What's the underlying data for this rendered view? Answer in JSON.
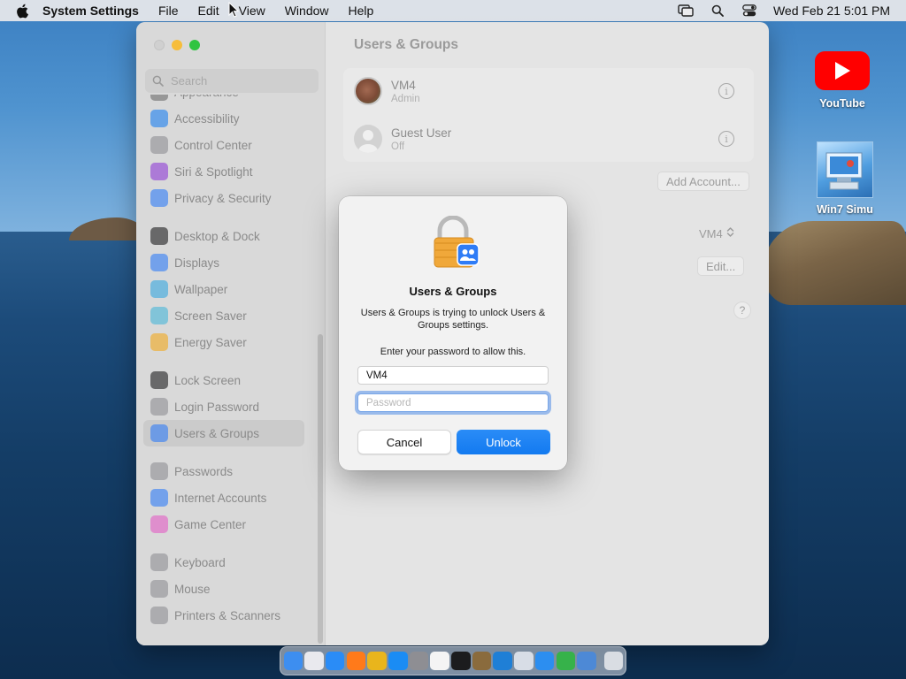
{
  "menubar": {
    "app_name": "System Settings",
    "menus": [
      "File",
      "Edit",
      "View",
      "Window",
      "Help"
    ],
    "clock": "Wed Feb 21  5:01 PM"
  },
  "window": {
    "title": "Users & Groups",
    "search_placeholder": "Search",
    "sidebar": [
      {
        "label": "Appearance",
        "icon": "appearance-icon",
        "color": "#6b6b6b"
      },
      {
        "label": "Accessibility",
        "icon": "accessibility-icon",
        "color": "#1a7ef0"
      },
      {
        "label": "Control Center",
        "icon": "control-center-icon",
        "color": "#8e8e93"
      },
      {
        "label": "Siri & Spotlight",
        "icon": "siri-icon",
        "color": "#8e3ad6"
      },
      {
        "label": "Privacy & Security",
        "icon": "hand-icon",
        "color": "#2f7cf6"
      },
      {
        "label": "Desktop & Dock",
        "icon": "dock-icon",
        "color": "#1c1c1e"
      },
      {
        "label": "Displays",
        "icon": "displays-icon",
        "color": "#2f7cf6"
      },
      {
        "label": "Wallpaper",
        "icon": "wallpaper-icon",
        "color": "#35a7e0"
      },
      {
        "label": "Screen Saver",
        "icon": "screen-saver-icon",
        "color": "#46b6d8"
      },
      {
        "label": "Energy Saver",
        "icon": "energy-icon",
        "color": "#f2a81d"
      },
      {
        "label": "Lock Screen",
        "icon": "lock-screen-icon",
        "color": "#1c1c1e"
      },
      {
        "label": "Login Password",
        "icon": "login-password-icon",
        "color": "#8e8e93"
      },
      {
        "label": "Users & Groups",
        "icon": "users-groups-icon",
        "color": "#2f7cf6",
        "active": true
      },
      {
        "label": "Passwords",
        "icon": "key-icon",
        "color": "#8e8e93"
      },
      {
        "label": "Internet Accounts",
        "icon": "at-icon",
        "color": "#2f7cf6"
      },
      {
        "label": "Game Center",
        "icon": "game-center-icon",
        "color": "#e25cc4"
      },
      {
        "label": "Keyboard",
        "icon": "keyboard-icon",
        "color": "#8e8e93"
      },
      {
        "label": "Mouse",
        "icon": "mouse-icon",
        "color": "#8e8e93"
      },
      {
        "label": "Printers & Scanners",
        "icon": "printer-icon",
        "color": "#8e8e93"
      }
    ],
    "users": [
      {
        "name": "VM4",
        "role": "Admin"
      },
      {
        "name": "Guest User",
        "role": "Off"
      }
    ],
    "add_account_label": "Add Account...",
    "auto_login_value": "VM4",
    "edit_label": "Edit...",
    "help_label": "?"
  },
  "dialog": {
    "title": "Users & Groups",
    "message": "Users & Groups is trying to unlock Users & Groups settings.",
    "prompt": "Enter your password to allow this.",
    "username_value": "VM4",
    "password_placeholder": "Password",
    "cancel_label": "Cancel",
    "unlock_label": "Unlock"
  },
  "desktop": {
    "icons": [
      {
        "label": "YouTube"
      },
      {
        "label": "Win7 Simu"
      }
    ]
  },
  "dock": {
    "apps": [
      {
        "name": "finder-icon",
        "color": "#3d8ef0"
      },
      {
        "name": "launchpad-icon",
        "color": "#e9e9ee"
      },
      {
        "name": "safari-icon",
        "color": "#2a8cf7"
      },
      {
        "name": "firefox-icon",
        "color": "#ff7a1a"
      },
      {
        "name": "chrome-icon",
        "color": "#e9b51c"
      },
      {
        "name": "app-store-icon",
        "color": "#1a8cf4"
      },
      {
        "name": "system-settings-icon",
        "color": "#8e8e93"
      },
      {
        "name": "textedit-icon",
        "color": "#f4f4f4"
      },
      {
        "name": "terminal-icon",
        "color": "#1c1c1e"
      },
      {
        "name": "script-editor-icon",
        "color": "#8a6b3d"
      },
      {
        "name": "vscode-icon",
        "color": "#1f7fd6"
      },
      {
        "name": "preview-icon",
        "color": "#d8dde6"
      },
      {
        "name": "icloud-icon",
        "color": "#2c8ef0"
      },
      {
        "name": "numbers-icon",
        "color": "#36b24a"
      },
      {
        "name": "migration-icon",
        "color": "#4d89d6"
      },
      {
        "name": "trash-icon",
        "color": "#d9dde3"
      }
    ]
  }
}
